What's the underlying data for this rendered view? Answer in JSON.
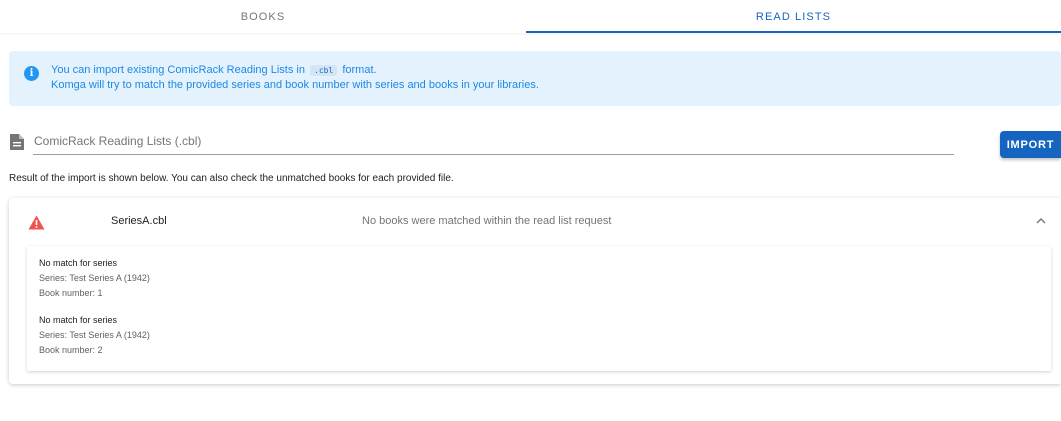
{
  "tabs": [
    {
      "label": "BOOKS",
      "active": false
    },
    {
      "label": "READ LISTS",
      "active": true
    }
  ],
  "alert": {
    "line1_pre": "You can import existing ComicRack Reading Lists in",
    "code": ".cbl",
    "line1_post": "format.",
    "line2": "Komga will try to match the provided series and book number with series and books in your libraries.",
    "icon": "info-icon",
    "color": "#2196f3"
  },
  "file_input": {
    "placeholder": "ComicRack Reading Lists (.cbl)",
    "value": "",
    "icon": "file-icon"
  },
  "import_button": {
    "label": "IMPORT",
    "color": "#1565c0"
  },
  "result_note": "Result of the import is shown below. You can also check the unmatched books for each provided file.",
  "results": [
    {
      "filename": "SeriesA.cbl",
      "status": "No books were matched within the read list request",
      "icon": "warning-icon",
      "icon_color": "#ef5350",
      "requests": [
        {
          "title": "No match for series",
          "series": "Series: Test Series A (1942)",
          "book": "Book number: 1"
        },
        {
          "title": "No match for series",
          "series": "Series: Test Series A (1942)",
          "book": "Book number: 2"
        }
      ]
    }
  ]
}
